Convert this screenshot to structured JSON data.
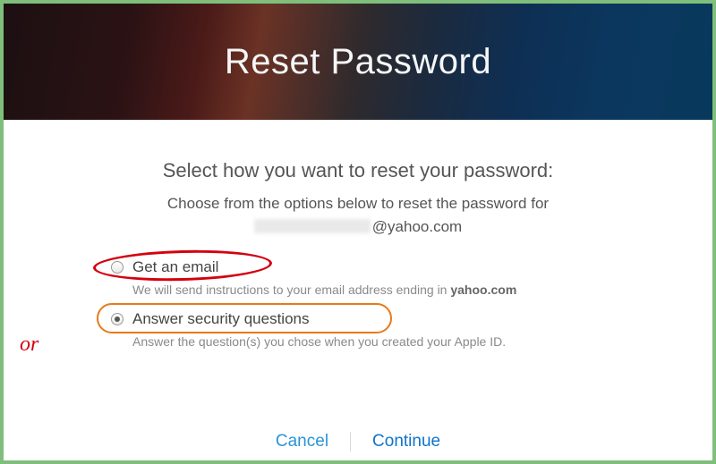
{
  "header": {
    "title": "Reset Password"
  },
  "main": {
    "headline": "Select how you want to reset your password:",
    "subtext": "Choose from the options below to reset the password for",
    "email_domain_suffix": "@yahoo.com"
  },
  "options": [
    {
      "id": "email",
      "label": "Get an email",
      "description_prefix": "We will send instructions to your email address ending in ",
      "description_bold": "yahoo.com",
      "selected": false
    },
    {
      "id": "security",
      "label": "Answer security questions",
      "description": "Answer the question(s) you chose when you created your Apple ID.",
      "selected": true
    }
  ],
  "footer": {
    "cancel": "Cancel",
    "continue": "Continue"
  },
  "annotations": {
    "or_label": "or"
  }
}
